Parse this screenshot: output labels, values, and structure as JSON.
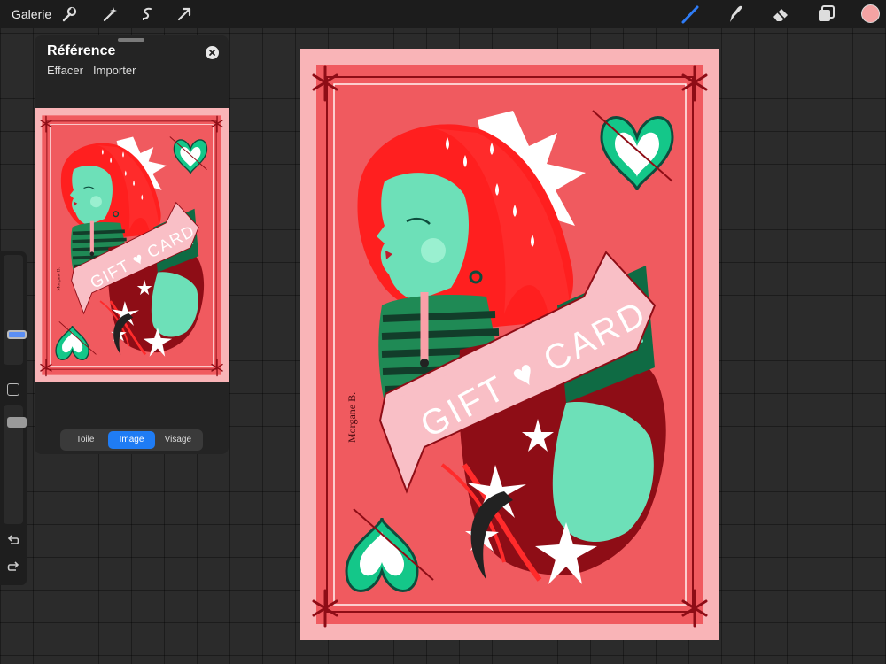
{
  "topbar": {
    "gallery_label": "Galerie",
    "left_tools": [
      "wrench-icon",
      "magic-wand-icon",
      "selection-icon",
      "transform-arrow-icon"
    ],
    "right_tools": [
      "brush-icon",
      "smudge-icon",
      "eraser-icon",
      "layers-icon"
    ],
    "current_color": "#f4a3a3",
    "active_tool_color": "#2f7cf6"
  },
  "sidebar": {
    "tools": [
      "brush-size-slider",
      "modify-button",
      "opacity-slider",
      "undo-icon",
      "redo-icon"
    ]
  },
  "reference": {
    "title": "Référence",
    "clear_label": "Effacer",
    "import_label": "Importer",
    "tabs": [
      {
        "label": "Toile"
      },
      {
        "label": "Image",
        "active": true
      },
      {
        "label": "Visage"
      }
    ]
  },
  "artwork": {
    "banner_text": "GIFT ♥ CARD",
    "signature": "Morgane B.",
    "colors": {
      "paper": "#f9b4b7",
      "card": "#f05a5f",
      "hair": "#ff1f1f",
      "hair_dark": "#8e0d16",
      "skin": "#6de0b8",
      "banner": "#f9bfc6",
      "heart_green": "#14c789"
    }
  }
}
